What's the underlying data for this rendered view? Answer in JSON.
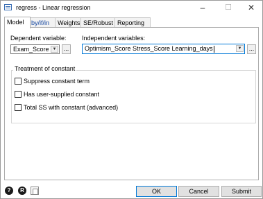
{
  "window": {
    "title": "regress - Linear regression"
  },
  "tabs": [
    {
      "label": "Model"
    },
    {
      "label": "by/if/in"
    },
    {
      "label": "Weights"
    },
    {
      "label": "SE/Robust"
    },
    {
      "label": "Reporting"
    }
  ],
  "model": {
    "dependent_label": "Dependent variable:",
    "dependent_value": "Exam_Score",
    "independent_label": "Independent variables:",
    "independent_value": "Optimism_Score Stress_Score Learning_days",
    "browse_label": "...",
    "constant_group_title": "Treatment of constant",
    "options": [
      {
        "label": "Suppress constant term",
        "checked": false
      },
      {
        "label": "Has user-supplied constant",
        "checked": false
      },
      {
        "label": "Total SS with constant (advanced)",
        "checked": false
      }
    ]
  },
  "footer": {
    "help_icon": "?",
    "reset_icon": "R",
    "ok_label": "OK",
    "cancel_label": "Cancel",
    "submit_label": "Submit"
  }
}
